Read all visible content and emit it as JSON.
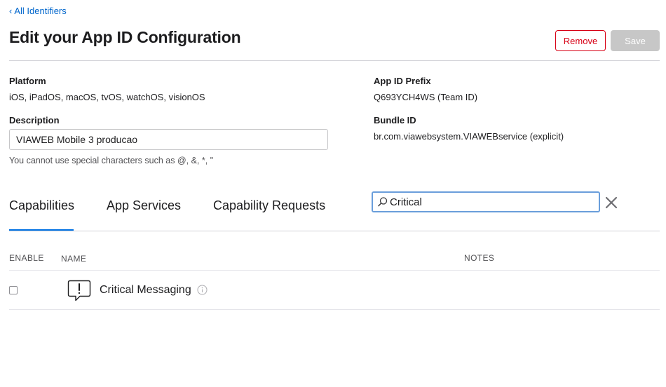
{
  "nav": {
    "back_label": "All Identifiers"
  },
  "header": {
    "title": "Edit your App ID Configuration",
    "remove_label": "Remove",
    "save_label": "Save"
  },
  "fields": {
    "platform": {
      "label": "Platform",
      "value": "iOS, iPadOS, macOS, tvOS, watchOS, visionOS"
    },
    "app_id_prefix": {
      "label": "App ID Prefix",
      "value": "Q693YCH4WS (Team ID)"
    },
    "description": {
      "label": "Description",
      "value": "VIAWEB Mobile 3 producao",
      "hint": "You cannot use special characters such as @, &, *, \""
    },
    "bundle_id": {
      "label": "Bundle ID",
      "value": "br.com.viawebsystem.VIAWEBservice (explicit)"
    }
  },
  "tabs": [
    {
      "label": "Capabilities",
      "active": true
    },
    {
      "label": "App Services",
      "active": false
    },
    {
      "label": "Capability Requests",
      "active": false
    }
  ],
  "search": {
    "value": "Critical"
  },
  "table": {
    "headers": {
      "enable": "ENABLE",
      "name": "NAME",
      "notes": "NOTES"
    },
    "rows": [
      {
        "name": "Critical Messaging",
        "enabled": false,
        "icon": "critical-message-icon"
      }
    ]
  },
  "colors": {
    "link": "#0066cc",
    "remove": "#d70015",
    "tab_active": "#0071e3",
    "search_focus": "#6a9edb"
  }
}
